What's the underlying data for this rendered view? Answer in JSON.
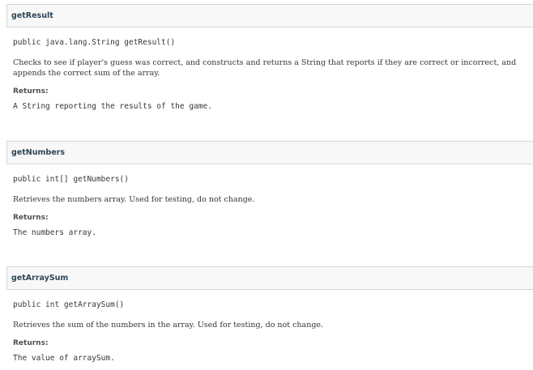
{
  "methods": [
    {
      "name": "getResult",
      "signature": "public java.lang.String getResult()",
      "description": "Checks to see if player's guess was correct, and constructs and returns a String that reports if they are correct or incorrect, and appends the correct sum of the array.",
      "returns_label": "Returns:",
      "returns_value": "A String reporting the results of the game."
    },
    {
      "name": "getNumbers",
      "signature": "public int[] getNumbers()",
      "description": "Retrieves the numbers array. Used for testing, do not change.",
      "returns_label": "Returns:",
      "returns_value": "The numbers array."
    },
    {
      "name": "getArraySum",
      "signature": "public int getArraySum()",
      "description": "Retrieves the sum of the numbers in the array. Used for testing, do not change.",
      "returns_label": "Returns:",
      "returns_value": "The value of arraySum."
    }
  ]
}
